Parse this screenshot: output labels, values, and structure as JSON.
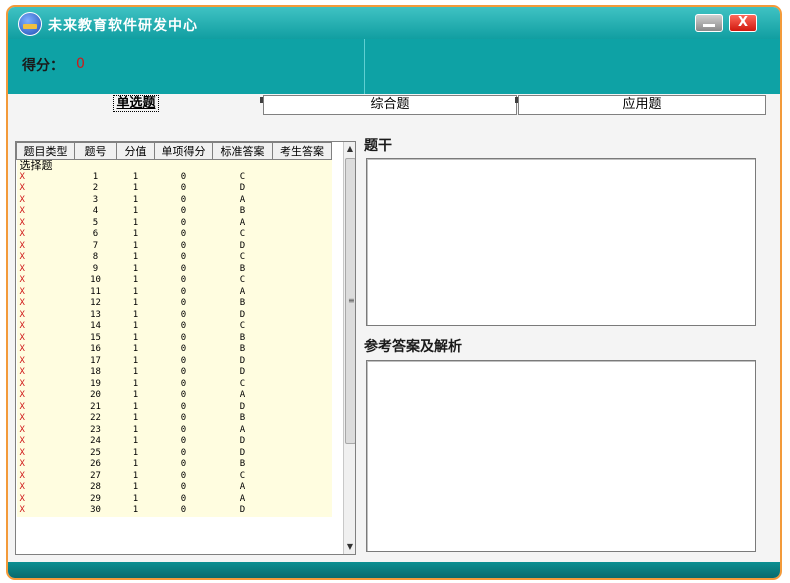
{
  "window": {
    "title": "未来教育软件研发中心",
    "minimize_glyph": "",
    "close_glyph": "X"
  },
  "score": {
    "label": "得分：",
    "value": "0"
  },
  "tabs": [
    {
      "label": "单选题",
      "active": true
    },
    {
      "label": "综合题",
      "active": false
    },
    {
      "label": "应用题",
      "active": false
    }
  ],
  "grid": {
    "columns": [
      "题目类型",
      "题号",
      "分值",
      "单项得分",
      "标准答案",
      "考生答案"
    ],
    "group_label": "选择题",
    "rows": [
      [
        "X",
        "1",
        "1",
        "0",
        "C",
        ""
      ],
      [
        "X",
        "2",
        "1",
        "0",
        "D",
        ""
      ],
      [
        "X",
        "3",
        "1",
        "0",
        "A",
        ""
      ],
      [
        "X",
        "4",
        "1",
        "0",
        "B",
        ""
      ],
      [
        "X",
        "5",
        "1",
        "0",
        "A",
        ""
      ],
      [
        "X",
        "6",
        "1",
        "0",
        "C",
        ""
      ],
      [
        "X",
        "7",
        "1",
        "0",
        "D",
        ""
      ],
      [
        "X",
        "8",
        "1",
        "0",
        "C",
        ""
      ],
      [
        "X",
        "9",
        "1",
        "0",
        "B",
        ""
      ],
      [
        "X",
        "10",
        "1",
        "0",
        "C",
        ""
      ],
      [
        "X",
        "11",
        "1",
        "0",
        "A",
        ""
      ],
      [
        "X",
        "12",
        "1",
        "0",
        "B",
        ""
      ],
      [
        "X",
        "13",
        "1",
        "0",
        "D",
        ""
      ],
      [
        "X",
        "14",
        "1",
        "0",
        "C",
        ""
      ],
      [
        "X",
        "15",
        "1",
        "0",
        "B",
        ""
      ],
      [
        "X",
        "16",
        "1",
        "0",
        "B",
        ""
      ],
      [
        "X",
        "17",
        "1",
        "0",
        "D",
        ""
      ],
      [
        "X",
        "18",
        "1",
        "0",
        "D",
        ""
      ],
      [
        "X",
        "19",
        "1",
        "0",
        "C",
        ""
      ],
      [
        "X",
        "20",
        "1",
        "0",
        "A",
        ""
      ],
      [
        "X",
        "21",
        "1",
        "0",
        "D",
        ""
      ],
      [
        "X",
        "22",
        "1",
        "0",
        "B",
        ""
      ],
      [
        "X",
        "23",
        "1",
        "0",
        "A",
        ""
      ],
      [
        "X",
        "24",
        "1",
        "0",
        "D",
        ""
      ],
      [
        "X",
        "25",
        "1",
        "0",
        "D",
        ""
      ],
      [
        "X",
        "26",
        "1",
        "0",
        "B",
        ""
      ],
      [
        "X",
        "27",
        "1",
        "0",
        "C",
        ""
      ],
      [
        "X",
        "28",
        "1",
        "0",
        "A",
        ""
      ],
      [
        "X",
        "29",
        "1",
        "0",
        "A",
        ""
      ],
      [
        "X",
        "30",
        "1",
        "0",
        "D",
        ""
      ]
    ],
    "scroll_up_glyph": "▲",
    "scroll_down_glyph": "▼",
    "scroll_grip_glyph": "≡"
  },
  "question_panel": {
    "label": "题干",
    "content": ""
  },
  "answer_panel": {
    "label": "参考答案及解析",
    "content": ""
  },
  "colors": {
    "teal": "#0ea2a5",
    "frame_border": "#f39a3a",
    "wrong_mark": "#d01818",
    "row_background": "#fffde0"
  }
}
